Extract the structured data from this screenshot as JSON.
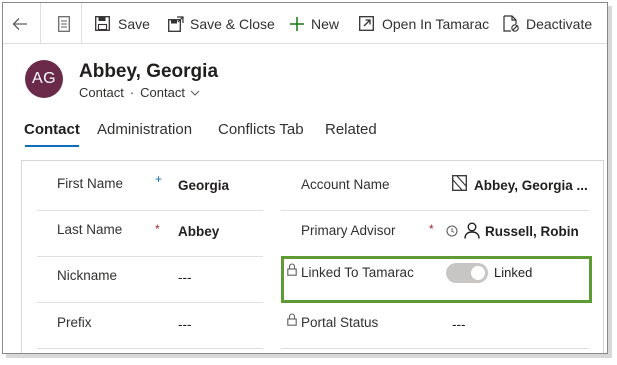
{
  "toolbar": {
    "back_icon": "back-arrow-icon",
    "page_icon": "record-page-icon",
    "save_label": "Save",
    "save_close_label": "Save & Close",
    "new_label": "New",
    "open_tamarac_label": "Open In Tamarac",
    "deactivate_label": "Deactivate"
  },
  "record": {
    "initials": "AG",
    "avatar_color": "#6b2a4a",
    "title": "Abbey, Georgia",
    "entity": "Contact",
    "form": "Contact"
  },
  "tabs": [
    {
      "label": "Contact",
      "active": true
    },
    {
      "label": "Administration",
      "active": false
    },
    {
      "label": "Conflicts Tab",
      "active": false
    },
    {
      "label": "Related",
      "active": false
    }
  ],
  "form": {
    "left": [
      {
        "label": "First Name",
        "required_mark": "+",
        "value": "Georgia"
      },
      {
        "label": "Last Name",
        "required_mark": "*",
        "value": "Abbey"
      },
      {
        "label": "Nickname",
        "value": "---"
      },
      {
        "label": "Prefix",
        "value": "---"
      }
    ],
    "right": [
      {
        "label": "Account Name",
        "value": "Abbey, Georgia ..."
      },
      {
        "label": "Primary Advisor",
        "required_mark": "*",
        "value": "Russell, Robin"
      },
      {
        "label": "Linked To Tamarac",
        "value": "Linked",
        "locked": true
      },
      {
        "label": "Portal Status",
        "value": "---",
        "locked": true
      }
    ]
  },
  "colors": {
    "accent": "#0f6cbd",
    "highlight_border": "#5e9b35",
    "required": "#a4262c"
  }
}
